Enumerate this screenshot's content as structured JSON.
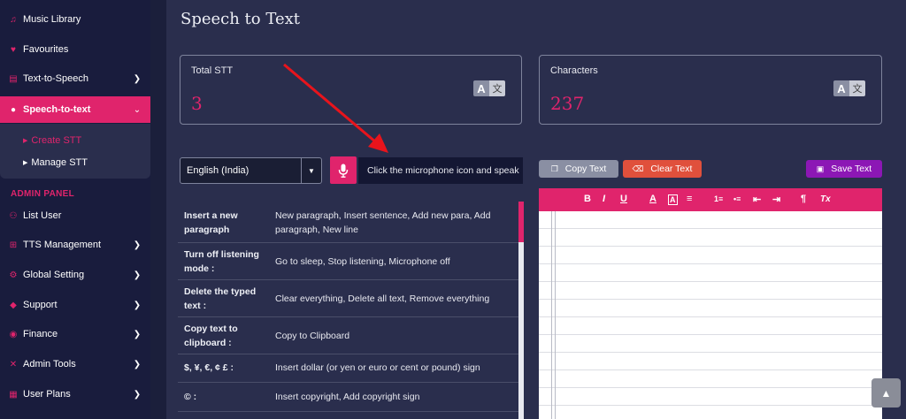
{
  "sidebar": {
    "items": [
      {
        "label": "Music Library",
        "icon": "music-icon"
      },
      {
        "label": "Favourites",
        "icon": "heart-icon"
      },
      {
        "label": "Text-to-Speech",
        "icon": "keyboard-icon"
      },
      {
        "label": "Speech-to-text",
        "icon": "microphone-icon"
      },
      {
        "label": "List User",
        "icon": "users-icon"
      },
      {
        "label": "TTS Management",
        "icon": "sitemap-icon"
      },
      {
        "label": "Global Setting",
        "icon": "gear-icon"
      },
      {
        "label": "Support",
        "icon": "tags-icon"
      },
      {
        "label": "Finance",
        "icon": "piggy-bank-icon"
      },
      {
        "label": "Admin Tools",
        "icon": "tools-icon"
      },
      {
        "label": "User Plans",
        "icon": "list-icon"
      }
    ],
    "submenu": [
      {
        "label": "Create STT"
      },
      {
        "label": "Manage STT"
      }
    ],
    "admin_heading": "ADMIN PANEL"
  },
  "page": {
    "title": "Speech to Text"
  },
  "stats": [
    {
      "label": "Total STT",
      "value": "3"
    },
    {
      "label": "Characters",
      "value": "237"
    }
  ],
  "controls": {
    "language": "English (India)",
    "mic_prompt": "Click the microphone icon and speak",
    "copy_label": "Copy Text",
    "clear_label": "Clear Text",
    "save_label": "Save Text"
  },
  "commands": [
    {
      "command": "Insert a new paragraph",
      "phrases": "New paragraph, Insert sentence, Add new para, Add paragraph, New line"
    },
    {
      "command": "Turn off listening mode :",
      "phrases": "Go to sleep, Stop listening, Microphone off"
    },
    {
      "command": "Delete the typed text :",
      "phrases": "Clear everything, Delete all text, Remove everything"
    },
    {
      "command": "Copy text to clipboard :",
      "phrases": "Copy to Clipboard"
    },
    {
      "command": "$, ¥, €, ¢ £ :",
      "phrases": "Insert dollar (or yen or euro or cent or pound) sign"
    },
    {
      "command": "© :",
      "phrases": "Insert copyright, Add copyright sign"
    }
  ],
  "toolbar": {
    "buttons": [
      {
        "glyph": "B",
        "icon": "bold-icon"
      },
      {
        "glyph": "I",
        "icon": "italic-icon"
      },
      {
        "glyph": "U",
        "icon": "underline-icon"
      },
      {
        "glyph": "A",
        "icon": "font-color-icon"
      },
      {
        "glyph": "A",
        "icon": "highlight-icon"
      },
      {
        "glyph": "≡",
        "icon": "align-icon"
      },
      {
        "glyph": "1≡",
        "icon": "ordered-list-icon"
      },
      {
        "glyph": "•≡",
        "icon": "unordered-list-icon"
      },
      {
        "glyph": "⇤",
        "icon": "outdent-icon"
      },
      {
        "glyph": "⇥",
        "icon": "indent-icon"
      },
      {
        "glyph": "¶",
        "icon": "paragraph-direction-icon"
      },
      {
        "glyph": "Tx",
        "icon": "clear-format-icon"
      }
    ]
  },
  "colors": {
    "accent": "#e0246c",
    "background": "#1b1f3b",
    "panel": "#2a2e4d",
    "save": "#8c17b5",
    "clear": "#e0503c",
    "annotation_arrow": "#e8141c"
  }
}
